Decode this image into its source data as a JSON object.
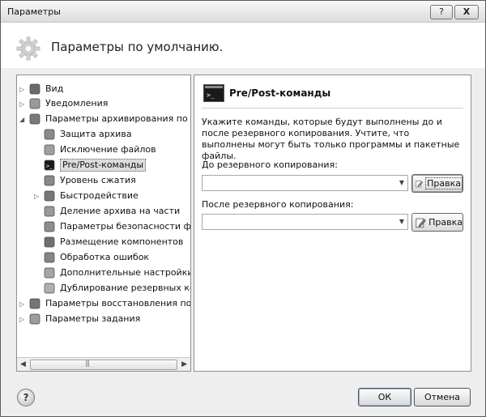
{
  "window": {
    "title": "Параметры",
    "help_label": "?",
    "close_label": "X"
  },
  "header": {
    "title": "Параметры по умолчанию."
  },
  "tree": {
    "items": [
      {
        "label": "Вид",
        "icon": "view-icon"
      },
      {
        "label": "Уведомления",
        "icon": "notifications-icon"
      },
      {
        "label": "Параметры архивирования по умол",
        "icon": "archive-icon"
      },
      {
        "label": "Защита архива",
        "icon": "lock-icon"
      },
      {
        "label": "Исключение файлов",
        "icon": "exclude-files-icon"
      },
      {
        "label": "Pre/Post-команды",
        "icon": "console-icon",
        "selected": true
      },
      {
        "label": "Уровень сжатия",
        "icon": "compression-icon"
      },
      {
        "label": "Быстродействие",
        "icon": "performance-icon"
      },
      {
        "label": "Деление архива на части",
        "icon": "split-archive-icon"
      },
      {
        "label": "Параметры безопасности файло",
        "icon": "security-icon"
      },
      {
        "label": "Размещение компонентов",
        "icon": "components-icon"
      },
      {
        "label": "Обработка ошибок",
        "icon": "error-handling-icon"
      },
      {
        "label": "Дополнительные настройки",
        "icon": "advanced-settings-icon"
      },
      {
        "label": "Дублирование резервных копи",
        "icon": "duplicate-icon"
      },
      {
        "label": "Параметры восстановления по умо",
        "icon": "restore-icon"
      },
      {
        "label": "Параметры задания",
        "icon": "task-icon"
      }
    ]
  },
  "panel": {
    "title": "Pre/Post-команды",
    "description": "Укажите команды, которые будут выполнены до и после резервного копирования. Учтите, что выполнены могут быть только программы и пакетные файлы.",
    "before_label": "До резервного копирования:",
    "before_value": "",
    "after_label": "После резервного копирования:",
    "after_value": "",
    "edit_label": "Правка"
  },
  "footer": {
    "ok_label": "ОК",
    "cancel_label": "Отмена",
    "help_label": "?"
  }
}
